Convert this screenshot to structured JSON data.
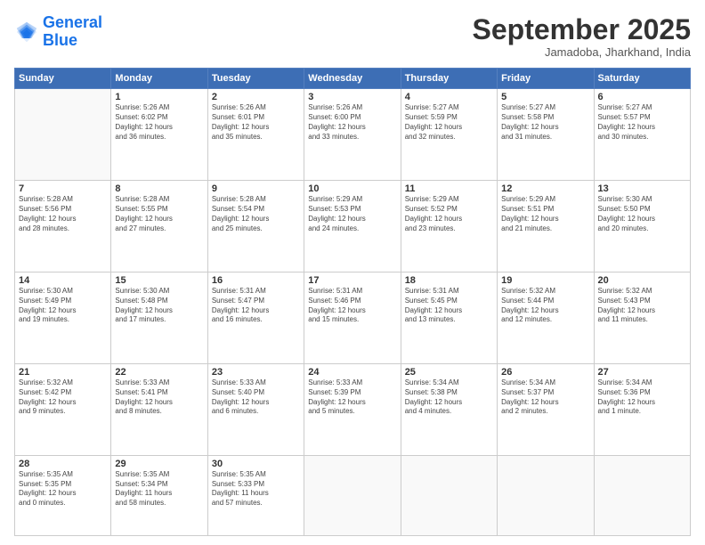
{
  "logo": {
    "line1": "General",
    "line2": "Blue"
  },
  "title": "September 2025",
  "location": "Jamadoba, Jharkhand, India",
  "weekdays": [
    "Sunday",
    "Monday",
    "Tuesday",
    "Wednesday",
    "Thursday",
    "Friday",
    "Saturday"
  ],
  "weeks": [
    [
      {
        "day": "",
        "info": ""
      },
      {
        "day": "1",
        "info": "Sunrise: 5:26 AM\nSunset: 6:02 PM\nDaylight: 12 hours\nand 36 minutes."
      },
      {
        "day": "2",
        "info": "Sunrise: 5:26 AM\nSunset: 6:01 PM\nDaylight: 12 hours\nand 35 minutes."
      },
      {
        "day": "3",
        "info": "Sunrise: 5:26 AM\nSunset: 6:00 PM\nDaylight: 12 hours\nand 33 minutes."
      },
      {
        "day": "4",
        "info": "Sunrise: 5:27 AM\nSunset: 5:59 PM\nDaylight: 12 hours\nand 32 minutes."
      },
      {
        "day": "5",
        "info": "Sunrise: 5:27 AM\nSunset: 5:58 PM\nDaylight: 12 hours\nand 31 minutes."
      },
      {
        "day": "6",
        "info": "Sunrise: 5:27 AM\nSunset: 5:57 PM\nDaylight: 12 hours\nand 30 minutes."
      }
    ],
    [
      {
        "day": "7",
        "info": "Sunrise: 5:28 AM\nSunset: 5:56 PM\nDaylight: 12 hours\nand 28 minutes."
      },
      {
        "day": "8",
        "info": "Sunrise: 5:28 AM\nSunset: 5:55 PM\nDaylight: 12 hours\nand 27 minutes."
      },
      {
        "day": "9",
        "info": "Sunrise: 5:28 AM\nSunset: 5:54 PM\nDaylight: 12 hours\nand 25 minutes."
      },
      {
        "day": "10",
        "info": "Sunrise: 5:29 AM\nSunset: 5:53 PM\nDaylight: 12 hours\nand 24 minutes."
      },
      {
        "day": "11",
        "info": "Sunrise: 5:29 AM\nSunset: 5:52 PM\nDaylight: 12 hours\nand 23 minutes."
      },
      {
        "day": "12",
        "info": "Sunrise: 5:29 AM\nSunset: 5:51 PM\nDaylight: 12 hours\nand 21 minutes."
      },
      {
        "day": "13",
        "info": "Sunrise: 5:30 AM\nSunset: 5:50 PM\nDaylight: 12 hours\nand 20 minutes."
      }
    ],
    [
      {
        "day": "14",
        "info": "Sunrise: 5:30 AM\nSunset: 5:49 PM\nDaylight: 12 hours\nand 19 minutes."
      },
      {
        "day": "15",
        "info": "Sunrise: 5:30 AM\nSunset: 5:48 PM\nDaylight: 12 hours\nand 17 minutes."
      },
      {
        "day": "16",
        "info": "Sunrise: 5:31 AM\nSunset: 5:47 PM\nDaylight: 12 hours\nand 16 minutes."
      },
      {
        "day": "17",
        "info": "Sunrise: 5:31 AM\nSunset: 5:46 PM\nDaylight: 12 hours\nand 15 minutes."
      },
      {
        "day": "18",
        "info": "Sunrise: 5:31 AM\nSunset: 5:45 PM\nDaylight: 12 hours\nand 13 minutes."
      },
      {
        "day": "19",
        "info": "Sunrise: 5:32 AM\nSunset: 5:44 PM\nDaylight: 12 hours\nand 12 minutes."
      },
      {
        "day": "20",
        "info": "Sunrise: 5:32 AM\nSunset: 5:43 PM\nDaylight: 12 hours\nand 11 minutes."
      }
    ],
    [
      {
        "day": "21",
        "info": "Sunrise: 5:32 AM\nSunset: 5:42 PM\nDaylight: 12 hours\nand 9 minutes."
      },
      {
        "day": "22",
        "info": "Sunrise: 5:33 AM\nSunset: 5:41 PM\nDaylight: 12 hours\nand 8 minutes."
      },
      {
        "day": "23",
        "info": "Sunrise: 5:33 AM\nSunset: 5:40 PM\nDaylight: 12 hours\nand 6 minutes."
      },
      {
        "day": "24",
        "info": "Sunrise: 5:33 AM\nSunset: 5:39 PM\nDaylight: 12 hours\nand 5 minutes."
      },
      {
        "day": "25",
        "info": "Sunrise: 5:34 AM\nSunset: 5:38 PM\nDaylight: 12 hours\nand 4 minutes."
      },
      {
        "day": "26",
        "info": "Sunrise: 5:34 AM\nSunset: 5:37 PM\nDaylight: 12 hours\nand 2 minutes."
      },
      {
        "day": "27",
        "info": "Sunrise: 5:34 AM\nSunset: 5:36 PM\nDaylight: 12 hours\nand 1 minute."
      }
    ],
    [
      {
        "day": "28",
        "info": "Sunrise: 5:35 AM\nSunset: 5:35 PM\nDaylight: 12 hours\nand 0 minutes."
      },
      {
        "day": "29",
        "info": "Sunrise: 5:35 AM\nSunset: 5:34 PM\nDaylight: 11 hours\nand 58 minutes."
      },
      {
        "day": "30",
        "info": "Sunrise: 5:35 AM\nSunset: 5:33 PM\nDaylight: 11 hours\nand 57 minutes."
      },
      {
        "day": "",
        "info": ""
      },
      {
        "day": "",
        "info": ""
      },
      {
        "day": "",
        "info": ""
      },
      {
        "day": "",
        "info": ""
      }
    ]
  ]
}
